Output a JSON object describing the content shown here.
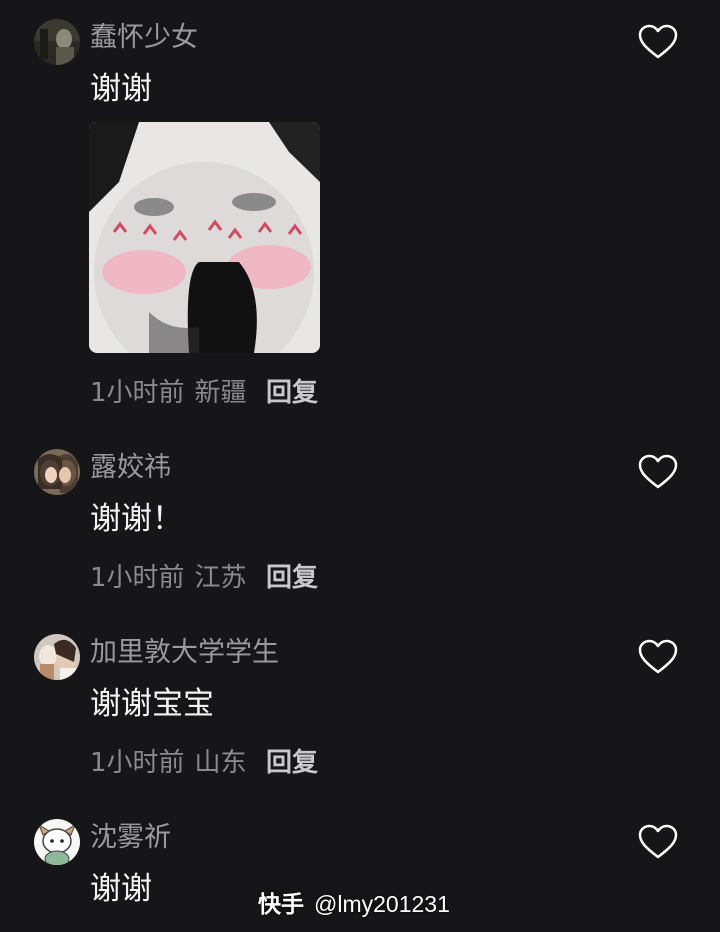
{
  "comments": [
    {
      "username": "蠢怀少女",
      "text": "谢谢",
      "time": "1小时前",
      "location": "新疆",
      "reply_label": "回复",
      "has_sticker": true
    },
    {
      "username": "露姣祎",
      "text": "谢谢！",
      "time": "1小时前",
      "location": "江苏",
      "reply_label": "回复"
    },
    {
      "username": "加里敦大学学生",
      "text": "谢谢宝宝",
      "time": "1小时前",
      "location": "山东",
      "reply_label": "回复"
    },
    {
      "username": "沈雾祈",
      "text": "谢谢"
    }
  ],
  "watermark": {
    "brand": "快手",
    "handle": "@lmy201231"
  },
  "icons": {
    "like": "heart-outline-icon"
  },
  "colors": {
    "background": "#161618",
    "username": "#9a9a9c",
    "comment_text": "#f3f3f3",
    "meta": "#8a8a8c",
    "reply": "#c9c9cb"
  }
}
